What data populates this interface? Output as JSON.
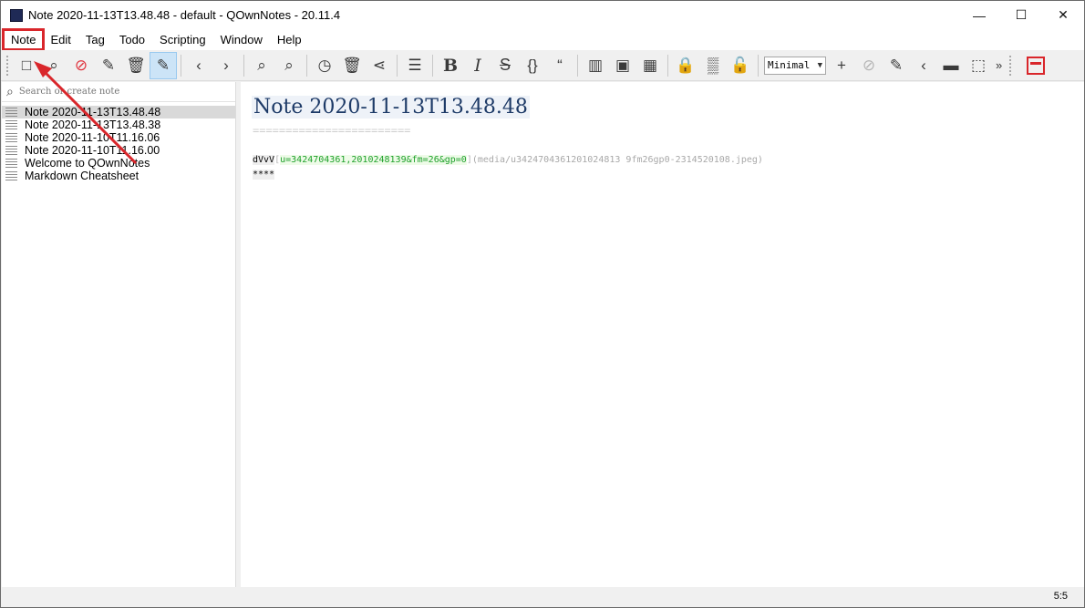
{
  "window": {
    "title": "Note 2020-11-13T13.48.48 - default - QOwnNotes - 20.11.4",
    "controls": {
      "minimize": "—",
      "maximize": "☐",
      "close": "✕"
    }
  },
  "menu": [
    "Note",
    "Edit",
    "Tag",
    "Todo",
    "Scripting",
    "Window",
    "Help"
  ],
  "toolbar": {
    "mode_dropdown": "Minimal",
    "icons": {
      "new_note": "□",
      "find": "⌕",
      "remove": "⊘",
      "edit_note": "✎",
      "delete": "🗑",
      "edit_mode": "✎",
      "back": "‹",
      "forward": "›",
      "find_in_notes": "⌕",
      "zoom": "⌕",
      "history": "◷",
      "trash": "🗑",
      "share": "⋖",
      "toc": "☰",
      "bold": "B",
      "italic": "I",
      "strike": "S",
      "code": "{}",
      "quote": "“",
      "split": "▥",
      "image": "▣",
      "calendar": "▦",
      "lock": "🔒",
      "encrypt": "▒",
      "unlock": "🔓",
      "add": "+",
      "no": "⊘",
      "pencil": "✎",
      "prev": "‹",
      "panel": "▬",
      "fullscreen": "⬚",
      "more": "»"
    }
  },
  "search": {
    "placeholder": "Search or create note"
  },
  "notes": [
    "Note 2020-11-13T13.48.48",
    "Note 2020-11-13T13.48.38",
    "Note 2020-11-10T11.16.06",
    "Note 2020-11-10T11.16.00",
    "Welcome to QOwnNotes",
    "Markdown Cheatsheet"
  ],
  "editor": {
    "heading": "Note 2020-11-13T13.48.48",
    "underline": "========================",
    "image_alt": "dVvV",
    "image_link": "u=3424704361,2010248139&fm=26&gp=0",
    "image_path": "(media/u3424704361201024813 9fm26gp0-2314520108.jpeg)",
    "stars": "****"
  },
  "status": {
    "cursor": "5:5"
  },
  "colors": {
    "highlight": "#d9262b",
    "heading": "#1d3a67",
    "link": "#1fa12b"
  }
}
